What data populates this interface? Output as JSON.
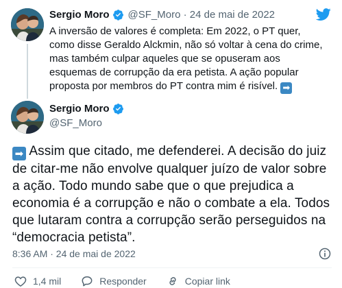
{
  "reply_tweet": {
    "author_name": "Sergio Moro",
    "handle_and_date": "@SF_Moro · 24 de mai de 2022",
    "text": "A inversão de valores é completa: Em 2022, o PT quer, como disse Geraldo Alckmin, não só voltar à cena do crime, mas também culpar aqueles que se opuseram aos esquemas de corrupção da era petista. A ação popular proposta por membros do PT contra mim é risível.",
    "trailing_emoji": "➡"
  },
  "main_tweet": {
    "author_name": "Sergio Moro",
    "handle": "@SF_Moro",
    "leading_emoji": "➡",
    "text": "Assim que citado, me defenderei. A decisão do juiz de citar-me não envolve qualquer juízo de valor sobre a ação. Todo mundo sabe que o que prejudica a economia é a corrupção e não o combate a ela. Todos que lutaram contra a corrupção serão perseguidos na “democracia petista”.",
    "timestamp": "8:36 AM · 24 de mai de 2022"
  },
  "actions": {
    "like_count": "1,4 mil",
    "reply_label": "Responder",
    "copy_link_label": "Copiar link"
  },
  "icons": {
    "twitter": "twitter-bird-icon",
    "verified": "verified-badge-icon",
    "info": "info-icon",
    "like": "heart-icon",
    "reply": "reply-icon",
    "copy_link": "link-icon"
  },
  "colors": {
    "brand_blue": "#1d9bf0",
    "text": "#0f1419",
    "muted": "#536471",
    "divider": "#eff3f4",
    "emoji_blue": "#3b88c3"
  }
}
